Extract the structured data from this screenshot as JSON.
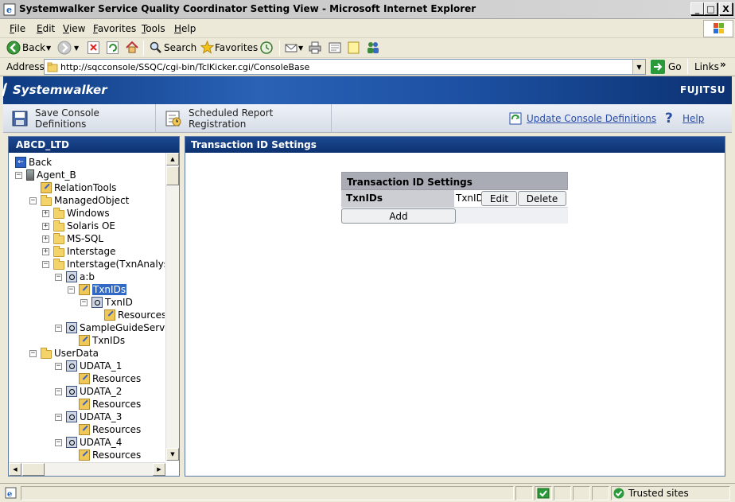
{
  "window": {
    "title": "Systemwalker Service Quality Coordinator Setting View - Microsoft Internet Explorer",
    "controls": [
      "_",
      "□",
      "X"
    ]
  },
  "menu": [
    "File",
    "Edit",
    "View",
    "Favorites",
    "Tools",
    "Help"
  ],
  "toolbar": {
    "back": "Back",
    "search": "Search",
    "favorites": "Favorites"
  },
  "address": {
    "label": "Address",
    "url": "http://sqcconsole/SSQC/cgi-bin/TclKicker.cgi/ConsoleBase",
    "go": "Go",
    "links": "Links"
  },
  "banner": {
    "brand": "Systemwalker",
    "vendor": "FUJITSU"
  },
  "console_toolbar": {
    "save": "Save Console Definitions",
    "report": "Scheduled Report Registration",
    "update": "Update Console Definitions",
    "help": "Help"
  },
  "tree": {
    "title": "ABCD_LTD",
    "items": [
      {
        "label": "Back",
        "icon": "back-icon"
      },
      {
        "label": "Agent_B",
        "icon": "server-icon"
      },
      {
        "label": "RelationTools",
        "icon": "tool-icon"
      },
      {
        "label": "ManagedObject",
        "icon": "folder-icon"
      },
      {
        "label": "Windows",
        "icon": "folder-icon"
      },
      {
        "label": "Solaris OE",
        "icon": "folder-icon"
      },
      {
        "label": "MS-SQL",
        "icon": "folder-icon"
      },
      {
        "label": "Interstage",
        "icon": "folder-icon"
      },
      {
        "label": "Interstage(TxnAnalysis",
        "icon": "folder-icon"
      },
      {
        "label": "a:b",
        "icon": "object-icon"
      },
      {
        "label": "TxnIDs",
        "icon": "tool-icon"
      },
      {
        "label": "TxnID",
        "icon": "object-icon"
      },
      {
        "label": "Resources",
        "icon": "tool-icon"
      },
      {
        "label": "SampleGuideServe",
        "icon": "object-icon"
      },
      {
        "label": "TxnIDs",
        "icon": "tool-icon"
      },
      {
        "label": "UserData",
        "icon": "folder-icon"
      },
      {
        "label": "UDATA_1",
        "icon": "object-icon"
      },
      {
        "label": "Resources",
        "icon": "tool-icon"
      },
      {
        "label": "UDATA_2",
        "icon": "object-icon"
      },
      {
        "label": "Resources",
        "icon": "tool-icon"
      },
      {
        "label": "UDATA_3",
        "icon": "object-icon"
      },
      {
        "label": "Resources",
        "icon": "tool-icon"
      },
      {
        "label": "UDATA_4",
        "icon": "object-icon"
      },
      {
        "label": "Resources",
        "icon": "tool-icon"
      }
    ]
  },
  "main": {
    "title": "Transaction ID Settings",
    "table": {
      "header": "Transaction ID Settings",
      "row_label": "TxnIDs",
      "row_value": "TxnID",
      "edit": "Edit",
      "delete": "Delete",
      "add": "Add"
    }
  },
  "status": {
    "zone": "Trusted sites"
  },
  "colors": {
    "panel_header": "#0d3170",
    "selection": "#316ac5",
    "link": "#2a4ea8"
  }
}
